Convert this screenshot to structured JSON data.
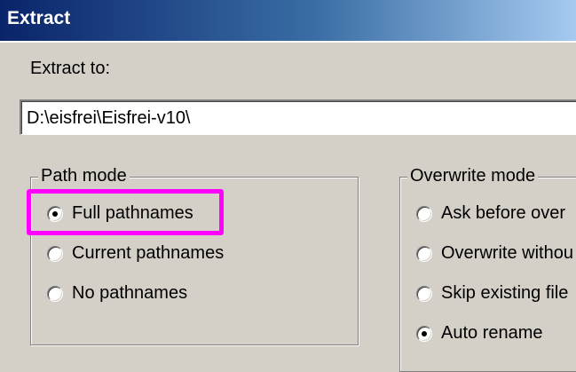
{
  "window": {
    "title": "Extract"
  },
  "extract_to": {
    "label": "Extract to:",
    "value": "D:\\eisfrei\\Eisfrei-v10\\"
  },
  "path_mode": {
    "label": "Path mode",
    "options": [
      {
        "label": "Full pathnames",
        "checked": true
      },
      {
        "label": "Current pathnames",
        "checked": false
      },
      {
        "label": "No pathnames",
        "checked": false
      }
    ]
  },
  "overwrite_mode": {
    "label": "Overwrite mode",
    "options": [
      {
        "label": "Ask before over",
        "checked": false
      },
      {
        "label": "Overwrite withou",
        "checked": false
      },
      {
        "label": "Skip existing file",
        "checked": false
      },
      {
        "label": "Auto rename",
        "checked": true
      }
    ]
  },
  "colors": {
    "titlebar_start": "#0a246a",
    "titlebar_end": "#a6caf0",
    "dialog_bg": "#d4d0c8",
    "highlight": "#ff00ff"
  }
}
